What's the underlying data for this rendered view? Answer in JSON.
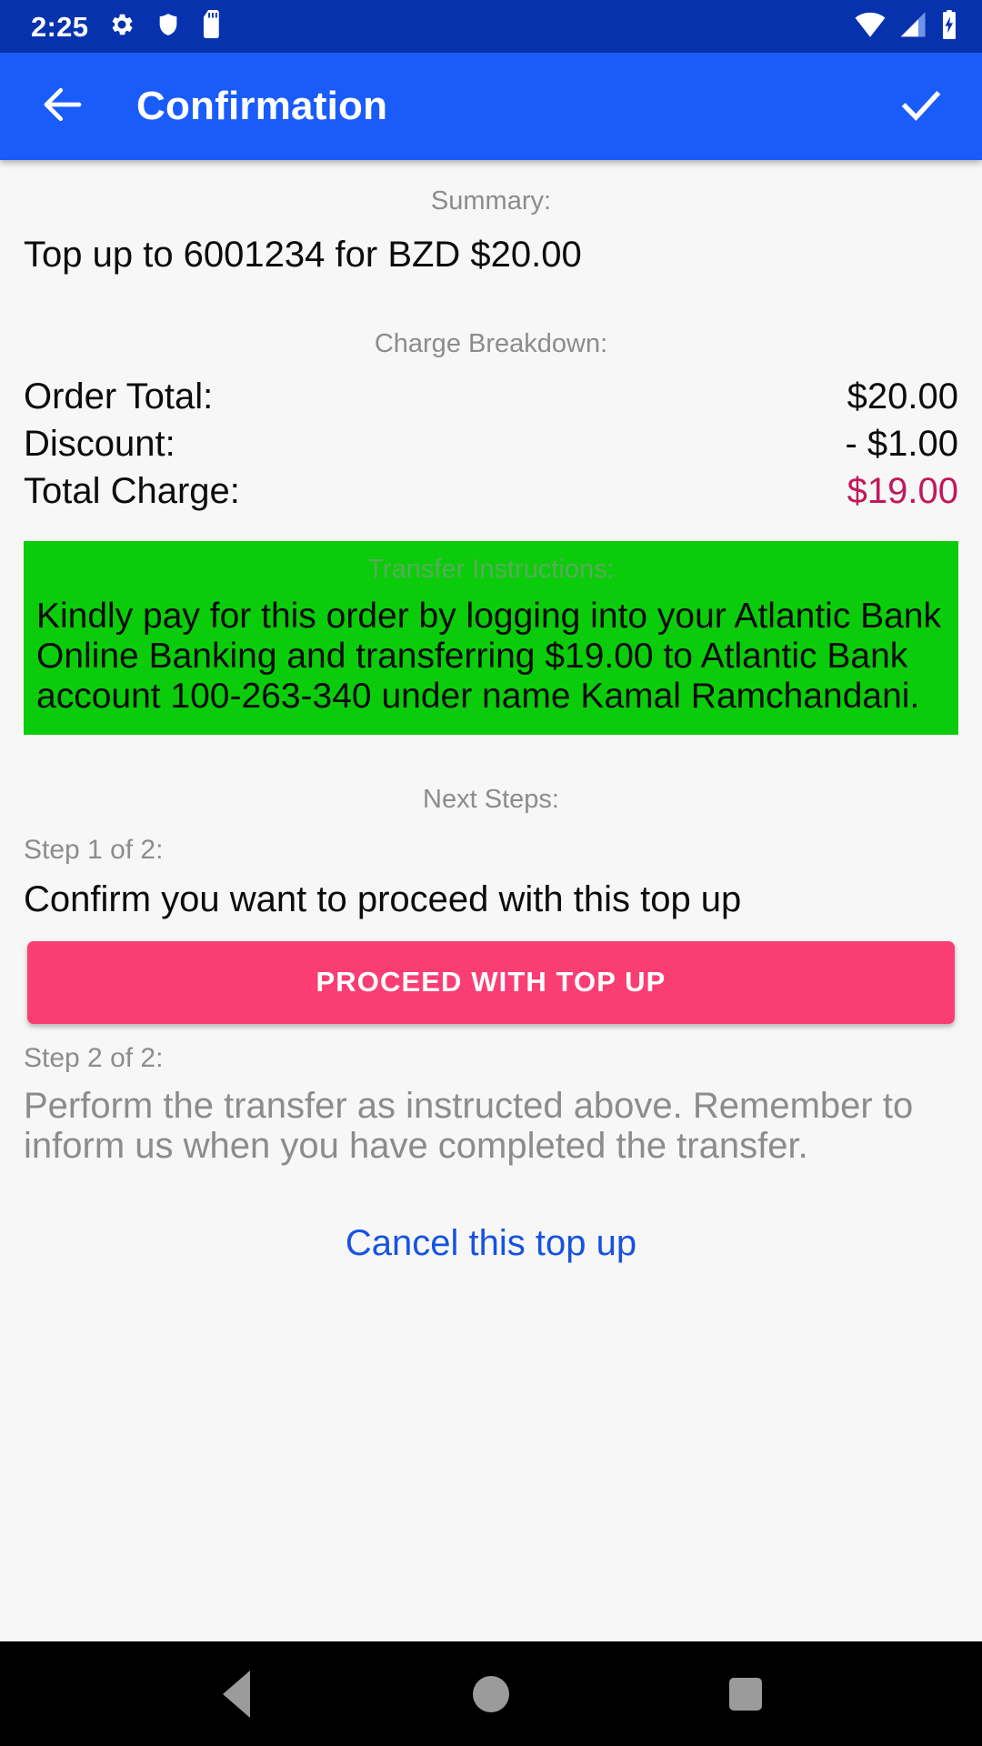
{
  "status_bar": {
    "time": "2:25",
    "left_icons": [
      "gear-icon",
      "shield-icon",
      "sd-card-icon"
    ],
    "right_icons": [
      "wifi-icon",
      "cellular-signal-icon",
      "battery-charging-icon"
    ],
    "background_color": "#0632AD"
  },
  "app_bar": {
    "title": "Confirmation",
    "back_icon": "arrow-left-icon",
    "confirm_icon": "check-icon",
    "background_color": "#1A5CFA"
  },
  "summary": {
    "label": "Summary:",
    "text": "Top up to 6001234 for BZD $20.00"
  },
  "charge_breakdown": {
    "label": "Charge Breakdown:",
    "rows": [
      {
        "label": "Order Total:",
        "value": "$20.00"
      },
      {
        "label": "Discount:",
        "value": "- $1.00"
      },
      {
        "label": "Total Charge:",
        "value": "$19.00"
      }
    ],
    "total_color": "#C2185B"
  },
  "transfer_instructions": {
    "heading": "Transfer Instructions:",
    "body": "Kindly pay for this order by logging into your Atlantic Bank Online Banking and transferring $19.00 to Atlantic Bank account 100-263-340 under name Kamal Ramchandani.",
    "background_color": "#0ACC0A"
  },
  "next_steps": {
    "label": "Next Steps:",
    "step1_label": "Step 1 of 2:",
    "step1_text": "Confirm you want to proceed with this top up",
    "proceed_button": "PROCEED WITH TOP UP",
    "proceed_button_color": "#FA3E73",
    "step2_label": "Step 2 of 2:",
    "step2_text": "Perform the transfer as instructed above. Remember to inform us when you have completed the transfer.",
    "cancel_link": "Cancel this top up",
    "cancel_link_color": "#1653E0"
  },
  "nav_bar": {
    "back_icon": "triangle-back-icon",
    "home_icon": "circle-home-icon",
    "recents_icon": "square-recents-icon"
  }
}
